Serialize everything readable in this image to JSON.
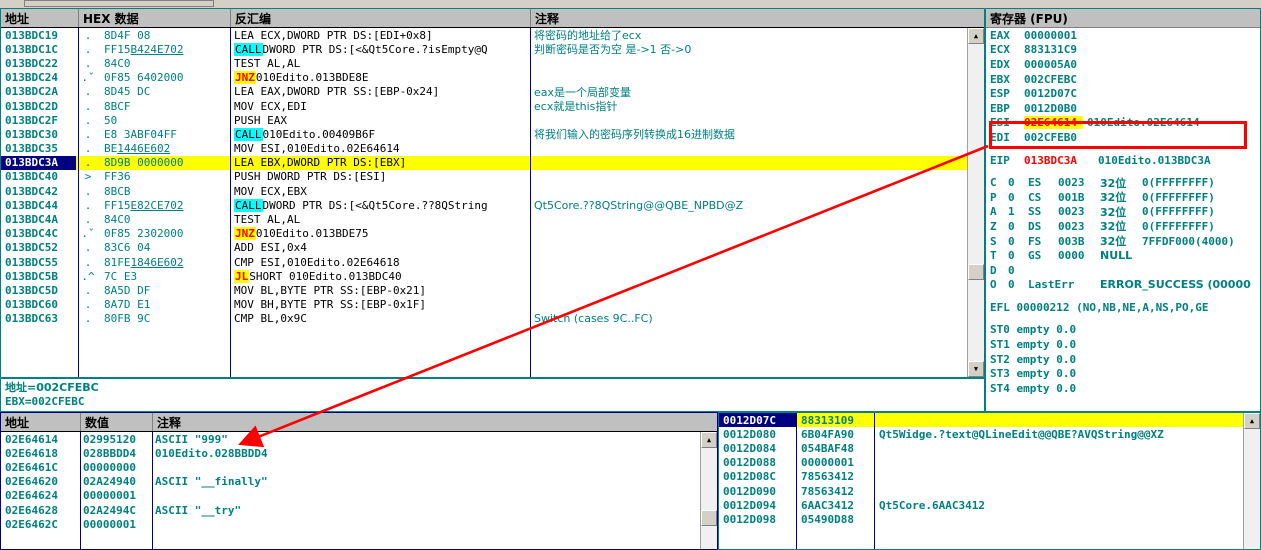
{
  "disassembly": {
    "columns": [
      "地址",
      "HEX 数据",
      "反汇编",
      "注释"
    ],
    "rows": [
      {
        "addr": "013BDC19",
        "mark": ".",
        "hex": "8D4F 08",
        "kw": "",
        "dis": "LEA ECX,DWORD PTR DS:[EDI+0x8]",
        "cmt": "将密码的地址给了ecx",
        "hl": "none",
        "hexu": ""
      },
      {
        "addr": "013BDC1C",
        "mark": ".",
        "hex": "FF15 ",
        "kw": "CALL",
        "dis": " DWORD PTR DS:[<&Qt5Core.?isEmpty@Q",
        "cmt": "判断密码是否为空 是->1 否->0",
        "hl": "none",
        "hexu": "B424E702"
      },
      {
        "addr": "013BDC22",
        "mark": ".",
        "hex": "84C0",
        "kw": "",
        "dis": "TEST AL,AL",
        "cmt": "",
        "hl": "none",
        "hexu": ""
      },
      {
        "addr": "013BDC24",
        "mark": ".ˇ",
        "hex": "0F85 6402000",
        "kw": "JNZ",
        "dis": " 010Edito.013BDE8E",
        "cmt": "",
        "hl": "none",
        "hexu": ""
      },
      {
        "addr": "013BDC2A",
        "mark": ".",
        "hex": "8D45 DC",
        "kw": "",
        "dis": "LEA EAX,DWORD PTR SS:[EBP-0x24]",
        "cmt": "eax是一个局部变量",
        "hl": "none",
        "hexu": ""
      },
      {
        "addr": "013BDC2D",
        "mark": ".",
        "hex": "8BCF",
        "kw": "",
        "dis": "MOV ECX,EDI",
        "cmt": "ecx就是this指针",
        "hl": "none",
        "hexu": ""
      },
      {
        "addr": "013BDC2F",
        "mark": ".",
        "hex": "50",
        "kw": "",
        "dis": "PUSH EAX",
        "cmt": "",
        "hl": "none",
        "hexu": ""
      },
      {
        "addr": "013BDC30",
        "mark": ".",
        "hex": "E8 3ABF04FF",
        "kw": "CALL",
        "dis": " 010Edito.00409B6F",
        "cmt": "将我们输入的密码序列转换成16进制数据",
        "hl": "none",
        "hexu": ""
      },
      {
        "addr": "013BDC35",
        "mark": ".",
        "hex": "BE ",
        "kw": "",
        "dis": "MOV ESI,010Edito.02E64614",
        "cmt": "",
        "hl": "none",
        "hexu": "1446E602"
      },
      {
        "addr": "013BDC3A",
        "mark": ".",
        "hex": "8D9B 0000000",
        "kw": "",
        "dis": "LEA EBX,DWORD PTR DS:[EBX]",
        "cmt": "",
        "hl": "eip",
        "hexu": ""
      },
      {
        "addr": "013BDC40",
        "mark": ">",
        "hex": "FF36",
        "kw": "",
        "dis": "PUSH DWORD PTR DS:[ESI]",
        "cmt": "",
        "hl": "none",
        "hexu": ""
      },
      {
        "addr": "013BDC42",
        "mark": ".",
        "hex": "8BCB",
        "kw": "",
        "dis": "MOV ECX,EBX",
        "cmt": "",
        "hl": "none",
        "hexu": ""
      },
      {
        "addr": "013BDC44",
        "mark": ".",
        "hex": "FF15 ",
        "kw": "CALL",
        "dis": " DWORD PTR DS:[<&Qt5Core.??8QString",
        "cmt": "Qt5Core.??8QString@@QBE_NPBD@Z",
        "hl": "none",
        "hexu": "E82CE702"
      },
      {
        "addr": "013BDC4A",
        "mark": ".",
        "hex": "84C0",
        "kw": "",
        "dis": "TEST AL,AL",
        "cmt": "",
        "hl": "none",
        "hexu": ""
      },
      {
        "addr": "013BDC4C",
        "mark": ".ˇ",
        "hex": "0F85 2302000",
        "kw": "JNZ",
        "dis": " 010Edito.013BDE75",
        "cmt": "",
        "hl": "none",
        "hexu": ""
      },
      {
        "addr": "013BDC52",
        "mark": ".",
        "hex": "83C6 04",
        "kw": "",
        "dis": "ADD ESI,0x4",
        "cmt": "",
        "hl": "none",
        "hexu": ""
      },
      {
        "addr": "013BDC55",
        "mark": ".",
        "hex": "81FE ",
        "kw": "",
        "dis": "CMP ESI,010Edito.02E64618",
        "cmt": "",
        "hl": "none",
        "hexu": "1846E602"
      },
      {
        "addr": "013BDC5B",
        "mark": ".^",
        "hex": "7C E3",
        "kw": "JL",
        "dis": " SHORT 010Edito.013BDC40",
        "cmt": "",
        "hl": "none",
        "hexu": ""
      },
      {
        "addr": "013BDC5D",
        "mark": ".",
        "hex": "8A5D DF",
        "kw": "",
        "dis": "MOV BL,BYTE PTR SS:[EBP-0x21]",
        "cmt": "",
        "hl": "none",
        "hexu": ""
      },
      {
        "addr": "013BDC60",
        "mark": ".",
        "hex": "8A7D E1",
        "kw": "",
        "dis": "MOV BH,BYTE PTR SS:[EBP-0x1F]",
        "cmt": "",
        "hl": "none",
        "hexu": ""
      },
      {
        "addr": "013BDC63",
        "mark": ".",
        "hex": "80FB 9C",
        "kw": "",
        "dis": "CMP BL,0x9C",
        "cmt": "Switch (cases 9C..FC)",
        "hl": "none",
        "hexu": ""
      }
    ]
  },
  "status": {
    "line1": "地址=002CFEBC",
    "line2": "EBX=002CFEBC"
  },
  "registers": {
    "title": "寄存器 (FPU)",
    "gpr": [
      {
        "name": "EAX",
        "value": "00000001",
        "comment": "",
        "hl": false
      },
      {
        "name": "ECX",
        "value": "883131C9",
        "comment": "",
        "hl": false
      },
      {
        "name": "EDX",
        "value": "000005A0",
        "comment": "",
        "hl": false
      },
      {
        "name": "EBX",
        "value": "002CFEBC",
        "comment": "",
        "hl": false
      },
      {
        "name": "ESP",
        "value": "0012D07C",
        "comment": "",
        "hl": false
      },
      {
        "name": "EBP",
        "value": "0012D0B0",
        "comment": "",
        "hl": false
      },
      {
        "name": "ESI",
        "value": "02E64614",
        "comment": "010Edito.02E64614",
        "hl": true
      },
      {
        "name": "EDI",
        "value": "002CFEB0",
        "comment": "",
        "hl": false
      }
    ],
    "eip": {
      "name": "EIP",
      "value": "013BDC3A",
      "comment": "010Edito.013BDC3A"
    },
    "flags": [
      {
        "f": "C",
        "v": "0",
        "seg": "ES",
        "sv": "0023",
        "bits": "32位",
        "desc": "0(FFFFFFFF)"
      },
      {
        "f": "P",
        "v": "0",
        "seg": "CS",
        "sv": "001B",
        "bits": "32位",
        "desc": "0(FFFFFFFF)"
      },
      {
        "f": "A",
        "v": "1",
        "seg": "SS",
        "sv": "0023",
        "bits": "32位",
        "desc": "0(FFFFFFFF)"
      },
      {
        "f": "Z",
        "v": "0",
        "seg": "DS",
        "sv": "0023",
        "bits": "32位",
        "desc": "0(FFFFFFFF)"
      },
      {
        "f": "S",
        "v": "0",
        "seg": "FS",
        "sv": "003B",
        "bits": "32位",
        "desc": "7FFDF000(4000)"
      },
      {
        "f": "T",
        "v": "0",
        "seg": "GS",
        "sv": "0000",
        "bits": "NULL",
        "desc": ""
      },
      {
        "f": "D",
        "v": "0",
        "seg": "",
        "sv": "",
        "bits": "",
        "desc": ""
      },
      {
        "f": "O",
        "v": "0",
        "seg": "LastErr",
        "sv": "",
        "bits": "ERROR_SUCCESS (00000",
        "desc": ""
      }
    ],
    "efl": "EFL 00000212 (NO,NB,NE,A,NS,PO,GE",
    "fpu": [
      "ST0 empty 0.0",
      "ST1 empty 0.0",
      "ST2 empty 0.0",
      "ST3 empty 0.0",
      "ST4 empty 0.0"
    ]
  },
  "dump": {
    "columns": [
      "地址",
      "数值",
      "注释"
    ],
    "rows": [
      {
        "addr": "02E64614",
        "value": "02995120",
        "comment": "ASCII \"999\""
      },
      {
        "addr": "02E64618",
        "value": "028BBDD4",
        "comment": "010Edito.028BBDD4"
      },
      {
        "addr": "02E6461C",
        "value": "00000000",
        "comment": ""
      },
      {
        "addr": "02E64620",
        "value": "02A24940",
        "comment": "ASCII \"__finally\""
      },
      {
        "addr": "02E64624",
        "value": "00000001",
        "comment": ""
      },
      {
        "addr": "02E64628",
        "value": "02A2494C",
        "comment": "ASCII \"__try\""
      },
      {
        "addr": "02E6462C",
        "value": "00000001",
        "comment": ""
      }
    ]
  },
  "stack": {
    "rows": [
      {
        "addr": "0012D07C",
        "value": "88313109",
        "comment": "",
        "hl": "eip"
      },
      {
        "addr": "0012D080",
        "value": "6B04FA90",
        "comment": "Qt5Widge.?text@QLineEdit@@QBE?AVQString@@XZ",
        "hl": "none"
      },
      {
        "addr": "0012D084",
        "value": "054BAF48",
        "comment": "",
        "hl": "none"
      },
      {
        "addr": "0012D088",
        "value": "00000001",
        "comment": "",
        "hl": "none"
      },
      {
        "addr": "0012D08C",
        "value": "78563412",
        "comment": "",
        "hl": "none"
      },
      {
        "addr": "0012D090",
        "value": "78563412",
        "comment": "",
        "hl": "none"
      },
      {
        "addr": "0012D094",
        "value": "6AAC3412",
        "comment": "Qt5Core.6AAC3412",
        "hl": "none"
      },
      {
        "addr": "0012D098",
        "value": "05490D88",
        "comment": "",
        "hl": "none"
      }
    ]
  },
  "annotation": {
    "arrow_color": "#ff0000",
    "box_color": "#ff0000"
  },
  "icons": {
    "scroll_up": "▲",
    "scroll_down": "▼"
  }
}
